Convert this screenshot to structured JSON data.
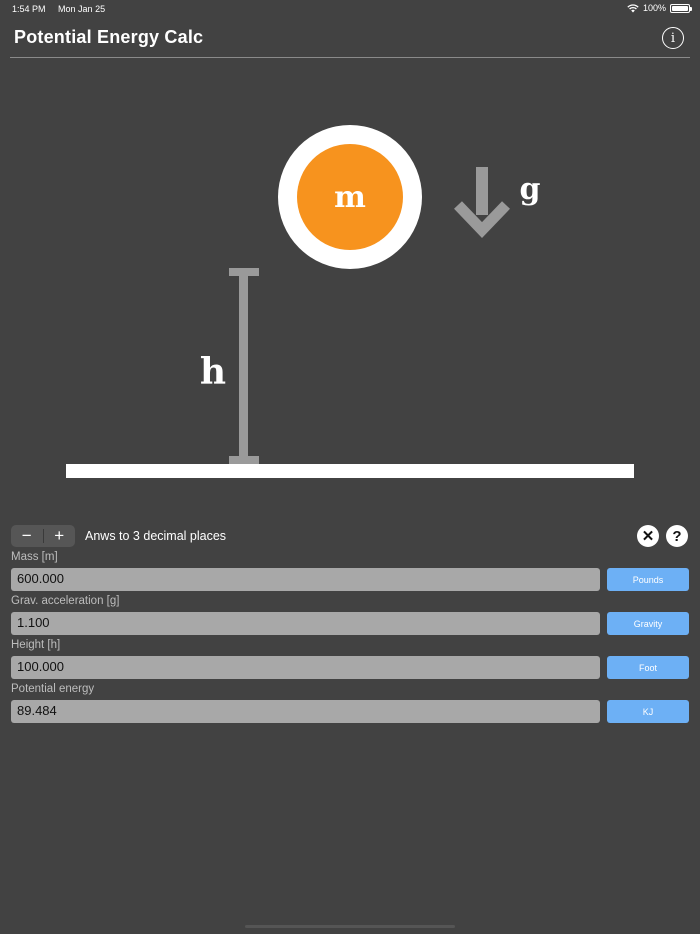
{
  "status_bar": {
    "time": "1:54 PM",
    "date": "Mon Jan 25",
    "battery": "100%"
  },
  "header": {
    "title": "Potential Energy Calc",
    "info_icon": "i"
  },
  "diagram": {
    "mass_label": "m",
    "gravity_label": "g",
    "height_label": "h"
  },
  "controls": {
    "minus": "−",
    "plus": "+",
    "decimal_text": "Anws to 3 decimal places",
    "clear_icon": "✕",
    "help_icon": "?"
  },
  "fields": {
    "mass": {
      "label": "Mass [m]",
      "value": "600.000",
      "unit": "Pounds"
    },
    "gravity": {
      "label": "Grav. acceleration [g]",
      "value": "1.100",
      "unit": "Gravity"
    },
    "height": {
      "label": "Height [h]",
      "value": "100.000",
      "unit": "Foot"
    },
    "energy": {
      "label": "Potential energy",
      "value": "89.484",
      "unit": "KJ"
    }
  },
  "colors": {
    "background": "#424242",
    "accent_orange": "#f7931e",
    "unit_button": "#6db0f5",
    "field_bg": "#a8a8a8"
  }
}
